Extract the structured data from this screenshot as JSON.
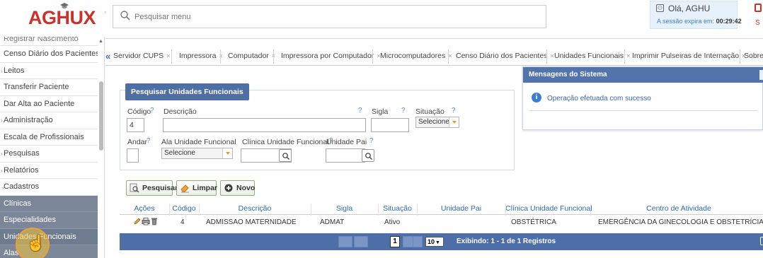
{
  "app": {
    "logo_text_1": "AG",
    "logo_text_2": "HU",
    "logo_text_3": "X"
  },
  "sidebar": {
    "items": [
      {
        "label": "Registrar Nascimento",
        "type": "cut"
      },
      {
        "label": "Censo Diário dos Pacientes",
        "type": "leaf"
      },
      {
        "label": "Leitos",
        "type": "group"
      },
      {
        "label": "Transferir Paciente",
        "type": "leaf"
      },
      {
        "label": "Dar Alta ao Paciente",
        "type": "leaf"
      },
      {
        "label": "Administração",
        "type": "group"
      },
      {
        "label": "Escala de Profissionais",
        "type": "leaf"
      },
      {
        "label": "Pesquisas",
        "type": "group"
      },
      {
        "label": "Relatórios",
        "type": "group"
      },
      {
        "label": "Cadastros",
        "type": "open"
      },
      {
        "label": "Clínicas",
        "type": "sub"
      },
      {
        "label": "Especialidades",
        "type": "sub"
      },
      {
        "label": "Unidades Funcionais",
        "type": "sub-active"
      },
      {
        "label": "Alas",
        "type": "sub"
      }
    ]
  },
  "header": {
    "search_placeholder": "Pesquisar menu",
    "greeting": "Olá, AGHU",
    "session_label": "A sessão expira em:",
    "session_time": "00:29:42",
    "logout_letter": "S"
  },
  "tabs": [
    {
      "label": "Servidor CUPS"
    },
    {
      "label": "Impressora"
    },
    {
      "label": "Computador"
    },
    {
      "label": "Impressora por Computador"
    },
    {
      "label": "Microcomputadores"
    },
    {
      "label": "Censo Diário dos Pacientes"
    },
    {
      "label": "Unidades Funcionais"
    },
    {
      "label": "Imprimir Pulseiras de Internação"
    },
    {
      "label": "Sobre"
    }
  ],
  "tab_close": "×",
  "form": {
    "legend": "Pesquisar Unidades Funcionais",
    "codigo_label": "Código",
    "codigo_value": "4",
    "descricao_label": "Descrição",
    "sigla_label": "Sigla",
    "situacao_label": "Situação",
    "situacao_value": "Selecione",
    "andar_label": "Andar",
    "ala_label": "Ala Unidade Funcional",
    "ala_value": "Selecione",
    "clinica_label": "Clínica Unidade Funcional",
    "unidade_pai_label": "Unidade Pai",
    "help": "?"
  },
  "buttons": {
    "pesquisar": "Pesquisar",
    "limpar": "Limpar",
    "novo": "Novo"
  },
  "table": {
    "columns": [
      "Ações",
      "Código",
      "Descrição",
      "Sigla",
      "Situação",
      "Unidade Pai",
      "Clínica Unidade Funcional",
      "Centro de Atividade"
    ],
    "rows": [
      {
        "codigo": "4",
        "descricao": "ADMISSAO MATERNIDADE",
        "sigla": "ADMAT",
        "situacao": "Ativo",
        "unidade_pai": "",
        "clinica": "OBSTÉTRICA",
        "centro": "EMERGÊNCIA DA GINECOLOGIA E OBSTETRÍCIA"
      }
    ]
  },
  "pager": {
    "current_page": "1",
    "page_size": "10",
    "info": "Exibindo: 1 - 1 de 1 Registros"
  },
  "messages": {
    "title": "Mensagens do Sistema",
    "text": "Operação efetuada com sucesso",
    "info_glyph": "i"
  },
  "colors": {
    "brand": "#c8332b",
    "accent": "#4d6ea7",
    "sidebar_sub": "#7b8799",
    "button_border": "#93b07a"
  }
}
